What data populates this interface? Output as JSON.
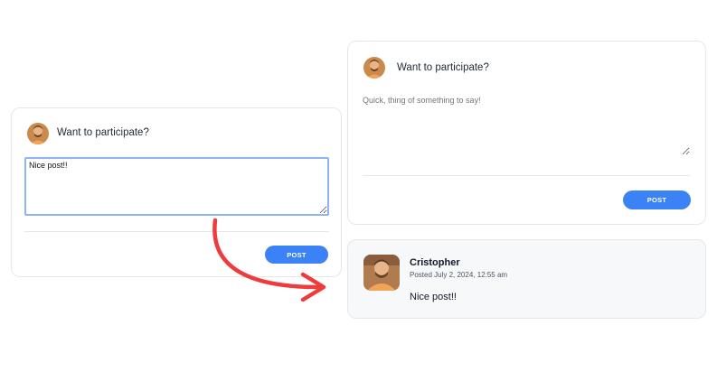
{
  "left_form": {
    "prompt": "Want to participate?",
    "textarea_value": "Nice post!!",
    "post_label": "POST"
  },
  "right_form": {
    "prompt": "Want to participate?",
    "textarea_placeholder": "Quick, thing of something to say!",
    "textarea_value": "",
    "post_label": "POST"
  },
  "comment": {
    "author": "Cristopher",
    "meta": "Posted July 2, 2024, 12:55 am",
    "body": "Nice post!!"
  },
  "colors": {
    "accent": "#3b82f6",
    "arrow": "#ef3b3b",
    "focus_border": "#8fb4f5"
  },
  "icons": {
    "avatar": "user-avatar-photo",
    "arrow": "curved-arrow-right"
  }
}
